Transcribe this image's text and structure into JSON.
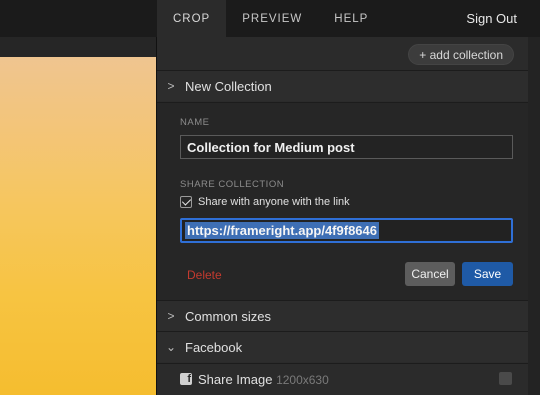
{
  "nav": {
    "tabs": [
      {
        "label": "CROP"
      },
      {
        "label": "PREVIEW"
      },
      {
        "label": "HELP"
      }
    ],
    "sign_out": "Sign Out"
  },
  "panel": {
    "add_collection": "+ add collection",
    "new_collection": {
      "label": "New Collection",
      "chevron": ">"
    },
    "form": {
      "name_label": "NAME",
      "name_value": "Collection for Medium post",
      "share_label": "SHARE COLLECTION",
      "share_checkbox_label": "Share with anyone with the link",
      "share_checked": true,
      "link_value": "https://frameright.app/4f9f8646",
      "delete": "Delete",
      "cancel": "Cancel",
      "save": "Save"
    },
    "sections": [
      {
        "label": "Common sizes",
        "chevron": ">"
      },
      {
        "label": "Facebook",
        "chevron": "⌄"
      }
    ],
    "facebook_item": {
      "label": "Share Image",
      "size": "1200x630",
      "icon": "facebook-icon"
    }
  },
  "colors": {
    "accent": "#1f5aa6",
    "focus_border": "#2f6fd6",
    "delete": "#c43a2f"
  }
}
